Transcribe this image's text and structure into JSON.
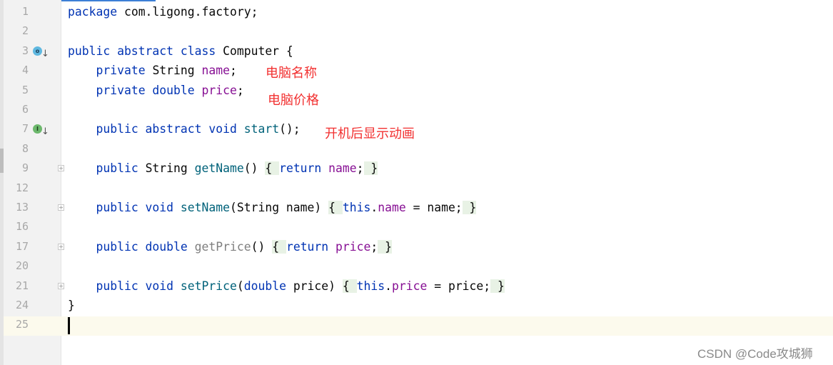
{
  "editor": {
    "lines": [
      {
        "num": "1",
        "tokens": [
          [
            "kw",
            "package "
          ],
          [
            "",
            "com.ligong.factory;"
          ]
        ]
      },
      {
        "num": "2",
        "tokens": []
      },
      {
        "num": "3",
        "gutter_icon": "override-class",
        "tokens": [
          [
            "kw",
            "public abstract class "
          ],
          [
            "",
            "Computer {"
          ]
        ]
      },
      {
        "num": "4",
        "tokens": [
          [
            "",
            "    "
          ],
          [
            "kw",
            "private "
          ],
          [
            "",
            "String "
          ],
          [
            "field",
            "name"
          ],
          [
            "",
            ";"
          ]
        ]
      },
      {
        "num": "5",
        "tokens": [
          [
            "",
            "    "
          ],
          [
            "kw",
            "private double "
          ],
          [
            "field",
            "price"
          ],
          [
            "",
            ";"
          ]
        ]
      },
      {
        "num": "6",
        "tokens": []
      },
      {
        "num": "7",
        "gutter_icon": "implemented-method",
        "tokens": [
          [
            "",
            "    "
          ],
          [
            "kw",
            "public abstract void "
          ],
          [
            "method",
            "start"
          ],
          [
            "",
            "();"
          ]
        ]
      },
      {
        "num": "8",
        "tokens": []
      },
      {
        "num": "9",
        "fold": true,
        "tokens": [
          [
            "",
            "    "
          ],
          [
            "kw",
            "public "
          ],
          [
            "",
            "String "
          ],
          [
            "method",
            "getName"
          ],
          [
            "",
            "() "
          ],
          [
            "brace",
            "{ "
          ],
          [
            "kw",
            "return "
          ],
          [
            "field",
            "name"
          ],
          [
            "",
            ";"
          ],
          [
            "brace",
            " }"
          ]
        ]
      },
      {
        "num": "12",
        "tokens": []
      },
      {
        "num": "13",
        "fold": true,
        "tokens": [
          [
            "",
            "    "
          ],
          [
            "kw",
            "public void "
          ],
          [
            "method",
            "setName"
          ],
          [
            "",
            "(String name) "
          ],
          [
            "brace",
            "{ "
          ],
          [
            "kw",
            "this"
          ],
          [
            "",
            "."
          ],
          [
            "field",
            "name"
          ],
          [
            "",
            " = name;"
          ],
          [
            "brace",
            " }"
          ]
        ]
      },
      {
        "num": "16",
        "tokens": []
      },
      {
        "num": "17",
        "fold": true,
        "tokens": [
          [
            "",
            "    "
          ],
          [
            "kw",
            "public double "
          ],
          [
            "unused",
            "getPrice"
          ],
          [
            "",
            "() "
          ],
          [
            "brace",
            "{ "
          ],
          [
            "kw",
            "return "
          ],
          [
            "field",
            "price"
          ],
          [
            "",
            ";"
          ],
          [
            "brace",
            " }"
          ]
        ]
      },
      {
        "num": "20",
        "tokens": []
      },
      {
        "num": "21",
        "fold": true,
        "tokens": [
          [
            "",
            "    "
          ],
          [
            "kw",
            "public void "
          ],
          [
            "method",
            "setPrice"
          ],
          [
            "",
            "("
          ],
          [
            "kw",
            "double "
          ],
          [
            "",
            "price) "
          ],
          [
            "brace",
            "{ "
          ],
          [
            "kw",
            "this"
          ],
          [
            "",
            "."
          ],
          [
            "field",
            "price"
          ],
          [
            "",
            " = price;"
          ],
          [
            "brace",
            " }"
          ]
        ]
      },
      {
        "num": "24",
        "tokens": [
          [
            "",
            "}"
          ]
        ]
      },
      {
        "num": "25",
        "current": true,
        "tokens": []
      }
    ]
  },
  "annotations": {
    "name_note": "电脑名称",
    "price_note": "电脑价格",
    "start_note": "开机后显示动画"
  },
  "watermark": "CSDN @Code攻城狮",
  "colors": {
    "keyword": "#0033b3",
    "field": "#871094",
    "method": "#00627a",
    "annotation": "#f23030"
  }
}
